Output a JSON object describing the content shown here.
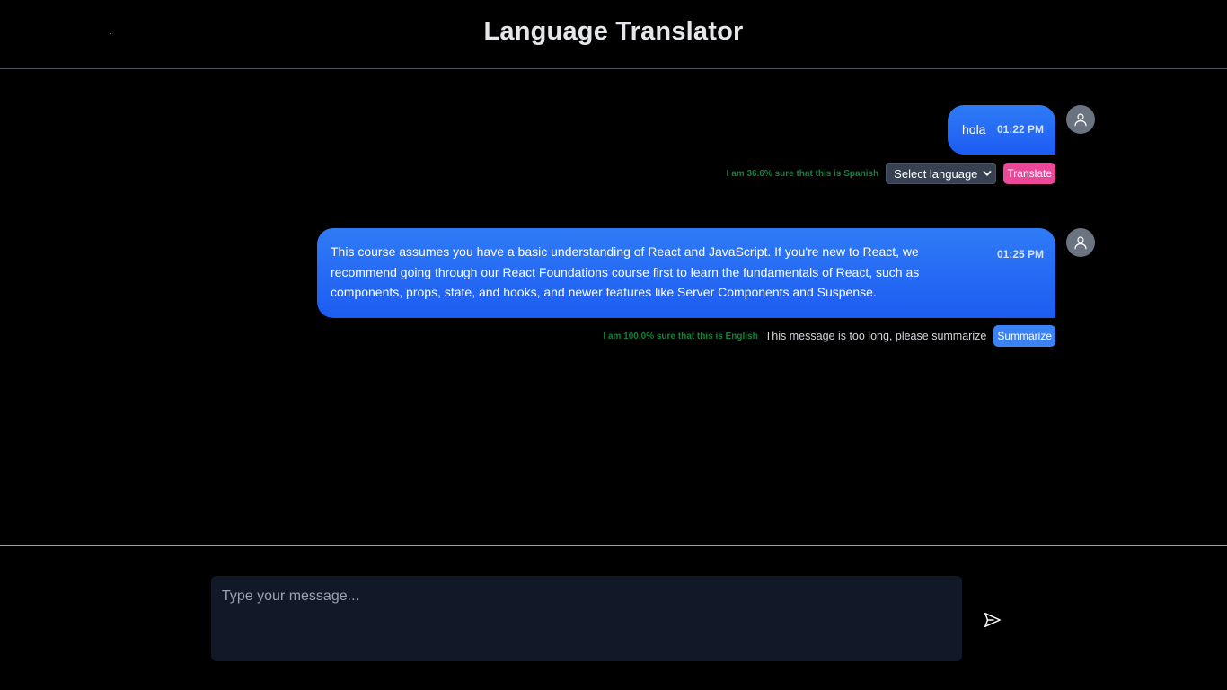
{
  "header": {
    "title": "Language Translator"
  },
  "messages": [
    {
      "text": "hola",
      "time": "01:22 PM",
      "confidence": "I am 36.6% sure that this is Spanish",
      "select_value": "Select language",
      "action_label": "Translate"
    },
    {
      "text": "This course assumes you have a basic understanding of React and JavaScript. If you're new to React, we recommend going through our React Foundations course first to learn the fundamentals of React, such as components, props, state, and hooks, and newer features like Server Components and Suspense.",
      "time": "01:25 PM",
      "confidence": "I am 100.0% sure that this is English",
      "notice": "This message is too long, please summarize",
      "action_label": "Summarize"
    }
  ],
  "composer": {
    "placeholder": "Type your message..."
  },
  "colors": {
    "background": "#000000",
    "bubble": "#2563eb",
    "translate_button": "#ec4899",
    "summarize_button": "#3b82f6",
    "confidence_text": "#15803d",
    "input_bg": "#111827"
  },
  "icons": {
    "avatar": "user-icon",
    "send": "send-icon",
    "dropdown": "chevron-down-icon"
  }
}
